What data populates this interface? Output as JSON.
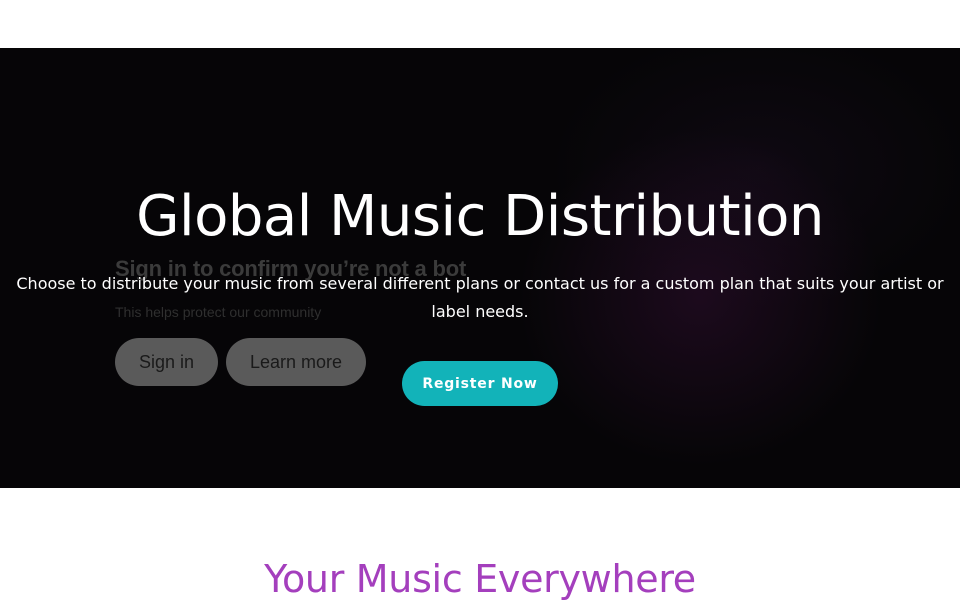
{
  "hero": {
    "title": "Global Music Distribution",
    "description": "Choose to distribute your music from several different plans or contact us for a custom plan that suits your artist or label needs.",
    "register_label": "Register Now"
  },
  "video_overlay": {
    "title": "Sign in to confirm you’re not a bot",
    "subtitle": "This helps protect our community",
    "sign_in_label": "Sign in",
    "learn_more_label": "Learn more"
  },
  "section": {
    "title": "Your Music Everywhere"
  },
  "colors": {
    "accent_teal": "#12b3b9",
    "heading_purple": "#a43fbd",
    "hero_background": "#060507"
  }
}
